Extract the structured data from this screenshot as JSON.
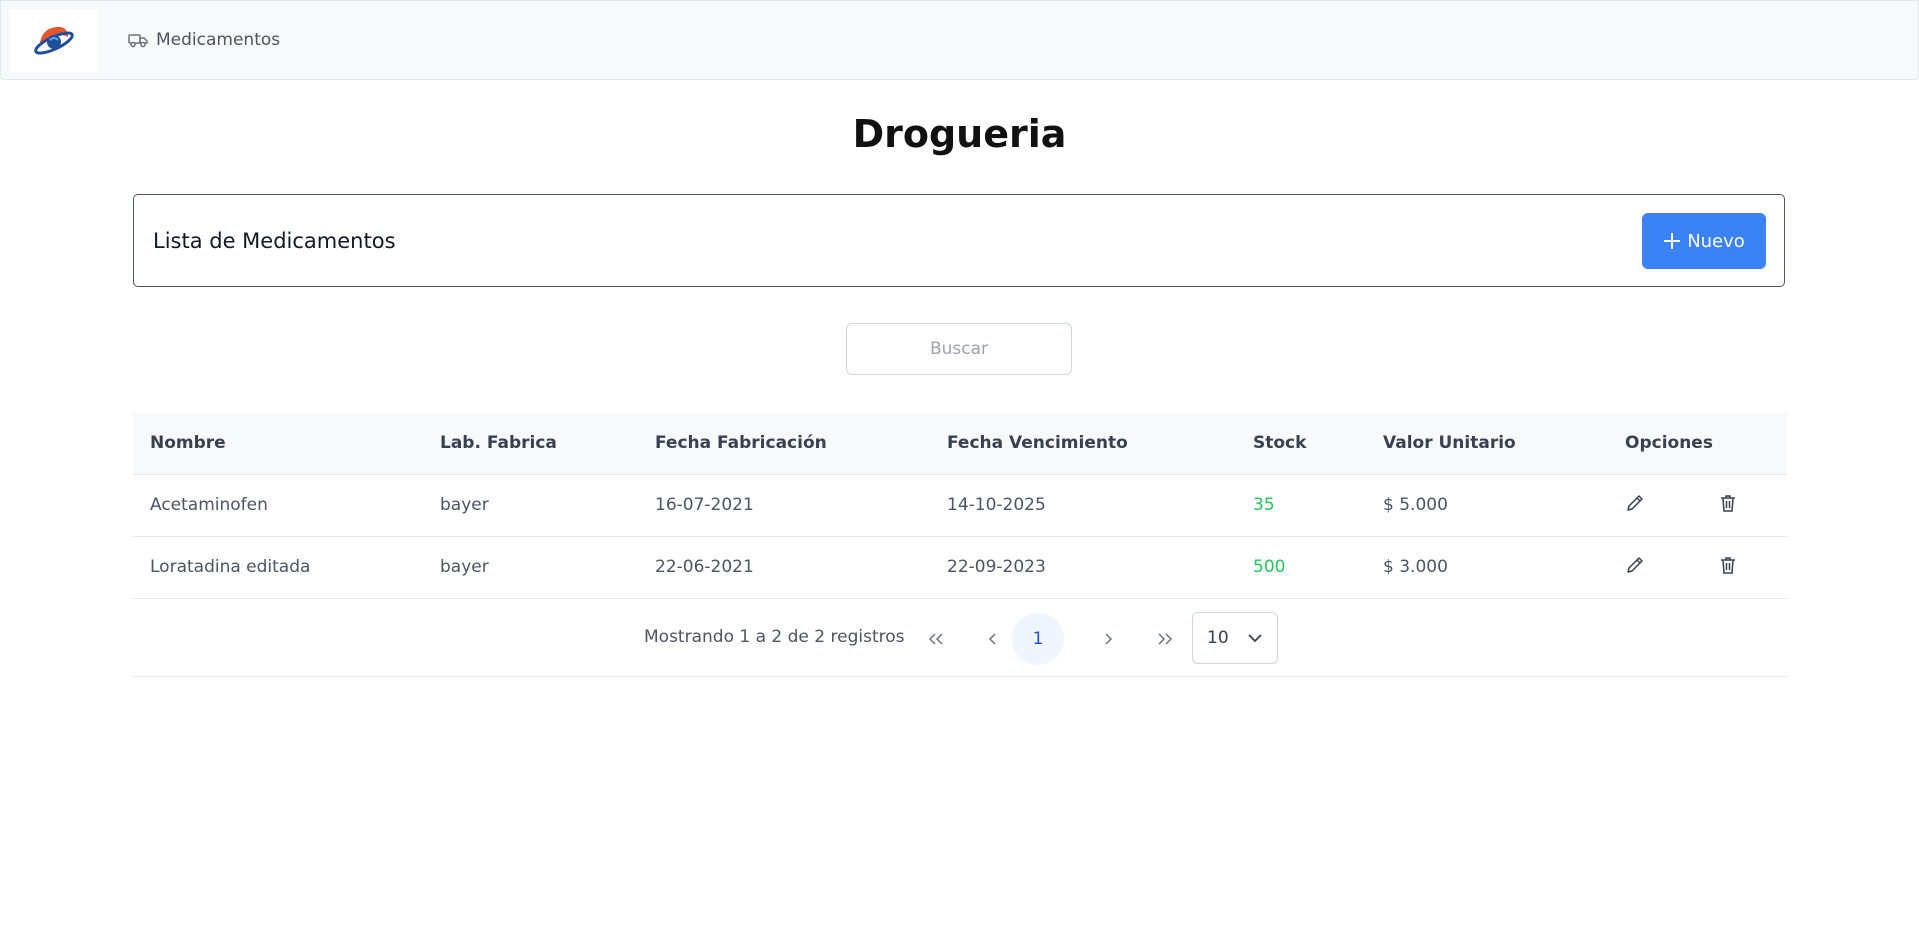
{
  "nav": {
    "medicamentos_label": "Medicamentos"
  },
  "page": {
    "title": "Drogueria"
  },
  "card": {
    "title": "Lista de Medicamentos",
    "new_button_label": "Nuevo"
  },
  "search": {
    "placeholder": "Buscar",
    "value": ""
  },
  "table": {
    "headers": [
      "Nombre",
      "Lab. Fabrica",
      "Fecha Fabricación",
      "Fecha Vencimiento",
      "Stock",
      "Valor Unitario",
      "Opciones"
    ],
    "rows": [
      {
        "nombre": "Acetaminofen",
        "lab": "bayer",
        "fecha_fabricacion": "16-07-2021",
        "fecha_vencimiento": "14-10-2025",
        "stock": "35",
        "valor": "$ 5.000"
      },
      {
        "nombre": "Loratadina editada",
        "lab": "bayer",
        "fecha_fabricacion": "22-06-2021",
        "fecha_vencimiento": "22-09-2023",
        "stock": "500",
        "valor": "$ 3.000"
      }
    ]
  },
  "pagination": {
    "info": "Mostrando 1 a 2 de 2 registros",
    "current_page": "1",
    "rows_per_page": "10"
  },
  "colors": {
    "primary": "#3b82f6",
    "stock": "#22c55e",
    "topbar": "#f8f9fa"
  }
}
